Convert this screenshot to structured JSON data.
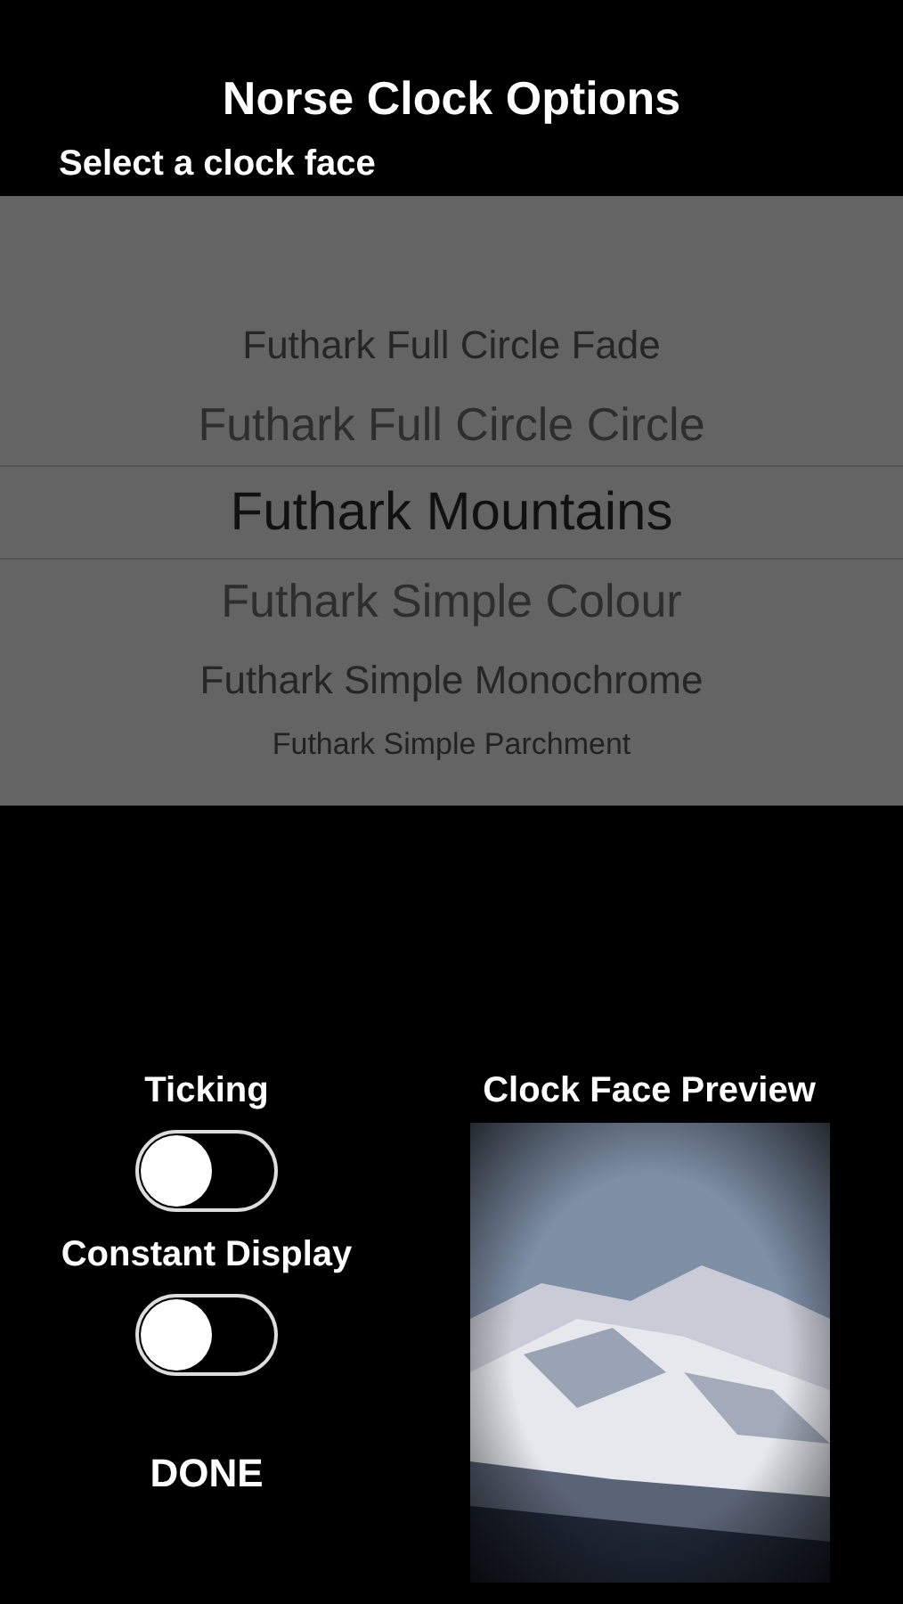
{
  "title": "Norse Clock Options",
  "subtitle": "Select a clock face",
  "picker": {
    "items": [
      {
        "label": "Futhark Full Circle Fade",
        "selected": false
      },
      {
        "label": "Futhark Full Circle Circle",
        "selected": false
      },
      {
        "label": "Futhark Mountains",
        "selected": true
      },
      {
        "label": "Futhark Simple Colour",
        "selected": false
      },
      {
        "label": "Futhark Simple Monochrome",
        "selected": false
      },
      {
        "label": "Futhark Simple Parchment",
        "selected": false
      }
    ]
  },
  "toggles": [
    {
      "label": "Ticking",
      "on": false
    },
    {
      "label": "Constant Display",
      "on": false
    }
  ],
  "done_button": "DONE",
  "preview": {
    "title": "Clock Face Preview",
    "kind": "picture"
  }
}
